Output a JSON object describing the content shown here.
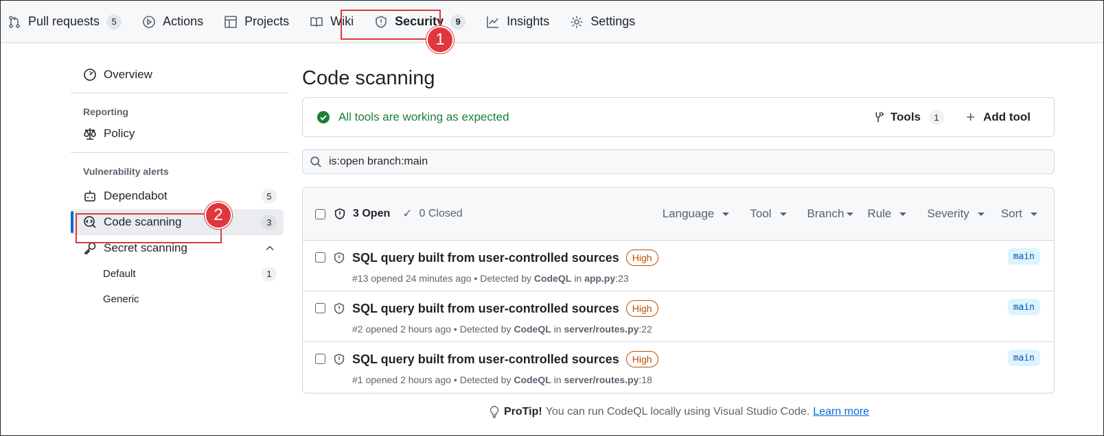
{
  "nav": {
    "items": [
      {
        "label": "Pull requests",
        "count": "5",
        "icon": "git-pull-request-icon"
      },
      {
        "label": "Actions",
        "icon": "play-icon"
      },
      {
        "label": "Projects",
        "icon": "table-icon"
      },
      {
        "label": "Wiki",
        "icon": "book-icon"
      },
      {
        "label": "Security",
        "count": "9",
        "icon": "shield-icon"
      },
      {
        "label": "Insights",
        "icon": "graph-icon"
      },
      {
        "label": "Settings",
        "icon": "gear-icon"
      }
    ],
    "selected": "Security"
  },
  "annotations": {
    "step1": "1",
    "step2": "2",
    "color": "#e0363c"
  },
  "sidebar": {
    "overview": "Overview",
    "reporting_heading": "Reporting",
    "policy": "Policy",
    "vuln_heading": "Vulnerability alerts",
    "dependabot": {
      "label": "Dependabot",
      "count": "5"
    },
    "code_scanning": {
      "label": "Code scanning",
      "count": "3"
    },
    "secret_scanning": {
      "label": "Secret scanning"
    },
    "default": {
      "label": "Default",
      "count": "1"
    },
    "generic": {
      "label": "Generic"
    }
  },
  "main": {
    "title": "Code scanning",
    "status": "All tools are working as expected",
    "tools_label": "Tools",
    "tools_count": "1",
    "add_tool": "Add tool",
    "search_value": "is:open branch:main",
    "open_label": "3 Open",
    "closed_label": "0 Closed",
    "filters": [
      "Language",
      "Tool",
      "Branch",
      "Rule",
      "Severity",
      "Sort"
    ],
    "alerts": [
      {
        "title": "SQL query built from user-controlled sources",
        "severity": "High",
        "number": "#13",
        "opened": "opened 24 minutes ago",
        "tool": "CodeQL",
        "file": "app.py",
        "line": ":23",
        "branch": "main"
      },
      {
        "title": "SQL query built from user-controlled sources",
        "severity": "High",
        "number": "#2",
        "opened": "opened 2 hours ago",
        "tool": "CodeQL",
        "file": "server/routes.py",
        "line": ":22",
        "branch": "main"
      },
      {
        "title": "SQL query built from user-controlled sources",
        "severity": "High",
        "number": "#1",
        "opened": "opened 2 hours ago",
        "tool": "CodeQL",
        "file": "server/routes.py",
        "line": ":18",
        "branch": "main"
      }
    ]
  },
  "protip": {
    "label": "ProTip!",
    "text": "You can run CodeQL locally using Visual Studio Code.",
    "link": "Learn more"
  },
  "colors": {
    "accent": "#0969da",
    "success": "#1a7f37",
    "severity_high": "#bc4c00"
  }
}
